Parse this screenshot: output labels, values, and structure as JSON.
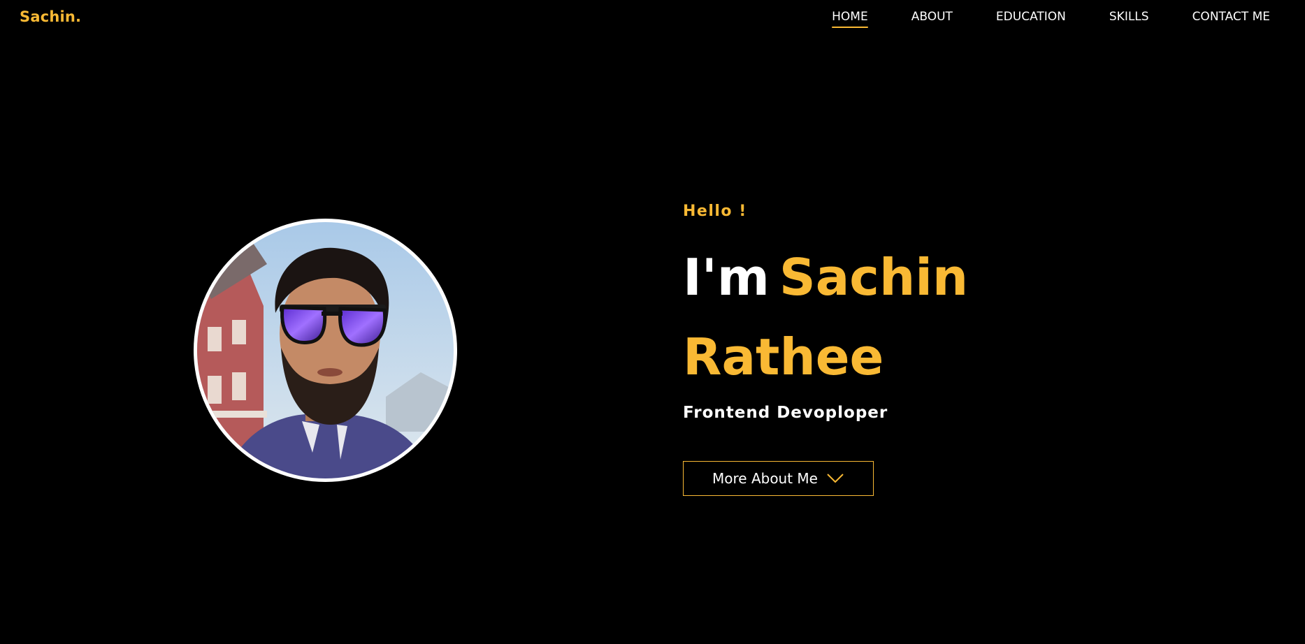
{
  "header": {
    "logo": "Sachin.",
    "nav": [
      {
        "label": "HOME",
        "active": true
      },
      {
        "label": "ABOUT",
        "active": false
      },
      {
        "label": "EDUCATION",
        "active": false
      },
      {
        "label": "SKILLS",
        "active": false
      },
      {
        "label": "CONTACT ME",
        "active": false
      }
    ]
  },
  "hero": {
    "greeting": "Hello !",
    "im": "I'm",
    "name": "Sachin Rathee",
    "role": "Frontend Devoploper",
    "button_label": "More About Me",
    "button_icon": "chevron-down-icon"
  },
  "theme": {
    "background": "#000000",
    "accent": "#f9b934",
    "text": "#ffffff"
  }
}
